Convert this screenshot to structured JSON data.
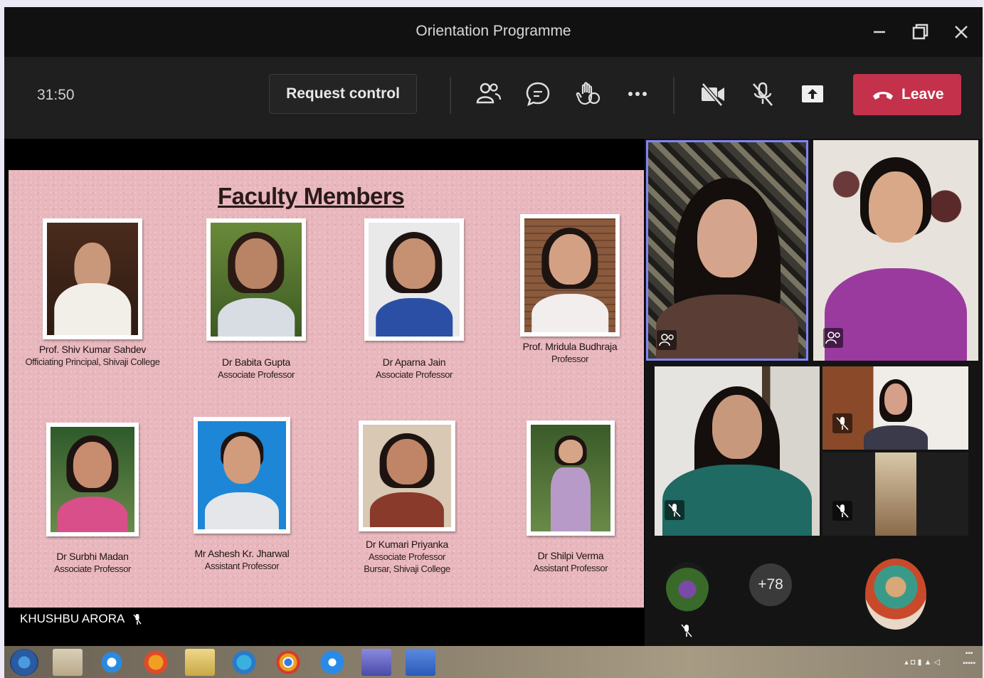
{
  "window": {
    "title": "Orientation Programme",
    "controls": [
      "minimize",
      "restore",
      "close"
    ]
  },
  "toolbar": {
    "timer": "31:50",
    "request_control_label": "Request control",
    "leave_label": "Leave",
    "leave_color": "#c4314b",
    "icons": [
      "people-icon",
      "chat-icon",
      "react-icon",
      "more-icon",
      "camera-off-icon",
      "mic-off-icon",
      "share-icon"
    ]
  },
  "slide": {
    "title": "Faculty Members",
    "background_color": "#e8b7bd",
    "faculty": [
      {
        "name": "Prof. Shiv Kumar Sahdev",
        "designation": "Officiating Principal, Shivaji College"
      },
      {
        "name": "Dr Babita Gupta",
        "designation": "Associate Professor"
      },
      {
        "name": "Dr Aparna Jain",
        "designation": "Associate Professor"
      },
      {
        "name": "Prof. Mridula Budhraja",
        "designation": "Professor"
      },
      {
        "name": "Dr Surbhi Madan",
        "designation": "Associate Professor"
      },
      {
        "name": "Mr Ashesh Kr. Jharwal",
        "designation": "Assistant Professor"
      },
      {
        "name": "Dr Kumari Priyanka",
        "designation": "Associate Professor",
        "extra": "Bursar, Shivaji College"
      },
      {
        "name": "Dr Shilpi Verma",
        "designation": "Assistant Professor"
      }
    ]
  },
  "presenter": {
    "name": "KHUSHBU ARORA"
  },
  "participants": {
    "overflow_count": "+78"
  }
}
